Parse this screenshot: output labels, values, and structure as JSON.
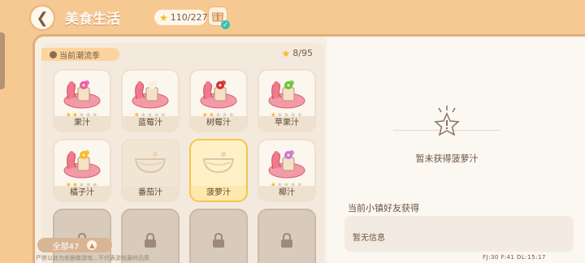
{
  "header": {
    "title": "美食生活",
    "collection_count": "110/227"
  },
  "left": {
    "current_tab": "当前潮流季",
    "progress": "8/95",
    "items": [
      {
        "label": "果汁",
        "stars": 2,
        "flower": "#f05aa8",
        "type": "drink"
      },
      {
        "label": "蓝莓汁",
        "stars": 1,
        "flower": "#f5f0e8",
        "type": "drink"
      },
      {
        "label": "树莓汁",
        "stars": 2,
        "flower": "#d42d3a",
        "type": "drink"
      },
      {
        "label": "苹果汁",
        "stars": 1,
        "flower": "#6cc33b",
        "type": "drink"
      },
      {
        "label": "橘子汁",
        "stars": 2,
        "flower": "#f7b92a",
        "type": "drink"
      },
      {
        "label": "番茄汁",
        "stars": 0,
        "flower": "",
        "type": "empty"
      },
      {
        "label": "菠萝汁",
        "stars": 0,
        "flower": "",
        "type": "empty-selected"
      },
      {
        "label": "椰汁",
        "stars": 1,
        "flower": "#c57ad8",
        "type": "drink"
      }
    ],
    "filter_label": "全部47",
    "footnote": "严禁以此为依据做游戏…不代表游戏最终品质"
  },
  "right": {
    "empty_text": "暂未获得菠萝汁",
    "friends_title": "当前小镇好友获得",
    "info_text": "暂无信息",
    "debug_text": "FJ:30  F:41  DL:15:17"
  },
  "colors": {
    "background": "#f7c992",
    "panel": "#f7efe3",
    "selected_border": "#f5c64d",
    "star_on": "#f5b52a"
  }
}
